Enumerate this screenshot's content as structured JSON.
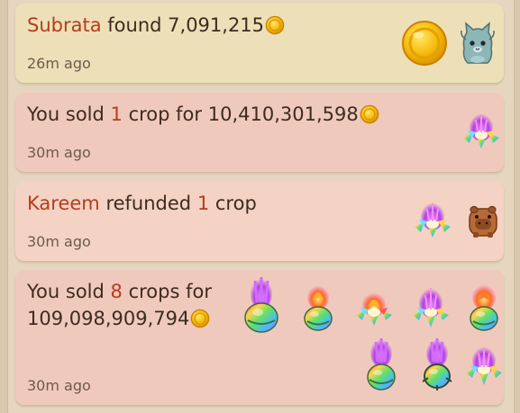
{
  "feed": {
    "found": {
      "player": "Subrata",
      "text": "found",
      "amount": "7,091,215",
      "time": "26m ago",
      "icons": [
        "gold-coin-icon",
        "gray-cat-pet-icon"
      ]
    },
    "sold_one": {
      "prefix": "You sold",
      "count": "1",
      "suffix": "crop for",
      "amount": "10,410,301,598",
      "time": "30m ago",
      "icons": [
        "rainbow-lotus-crop-icon"
      ]
    },
    "refund": {
      "player": "Kareem",
      "text": "refunded",
      "count": "1",
      "suffix": "crop",
      "time": "30m ago",
      "icons": [
        "rainbow-lotus-crop-icon",
        "capybara-pet-icon"
      ]
    },
    "sold_eight": {
      "prefix": "You sold",
      "count": "8",
      "suffix": "crops for",
      "amount": "109,098,909,794",
      "time": "30m ago",
      "icons": [
        "rainbow-egg-crop-icon",
        "rainbow-egg-crop-icon",
        "rainbow-lotus-crop-icon",
        "rainbow-lotus-crop-icon",
        "rainbow-egg-crop-icon",
        "rainbow-egg-crop-icon",
        "rainbow-egg-crop-icon",
        "rainbow-lotus-crop-icon"
      ]
    }
  },
  "colors": {
    "highlight": "#b43d1e",
    "found_card": "#ede0b8",
    "sold_card": "#f0c9bd",
    "refund_card": "#f4d3c4",
    "coin": "#f5b800"
  }
}
